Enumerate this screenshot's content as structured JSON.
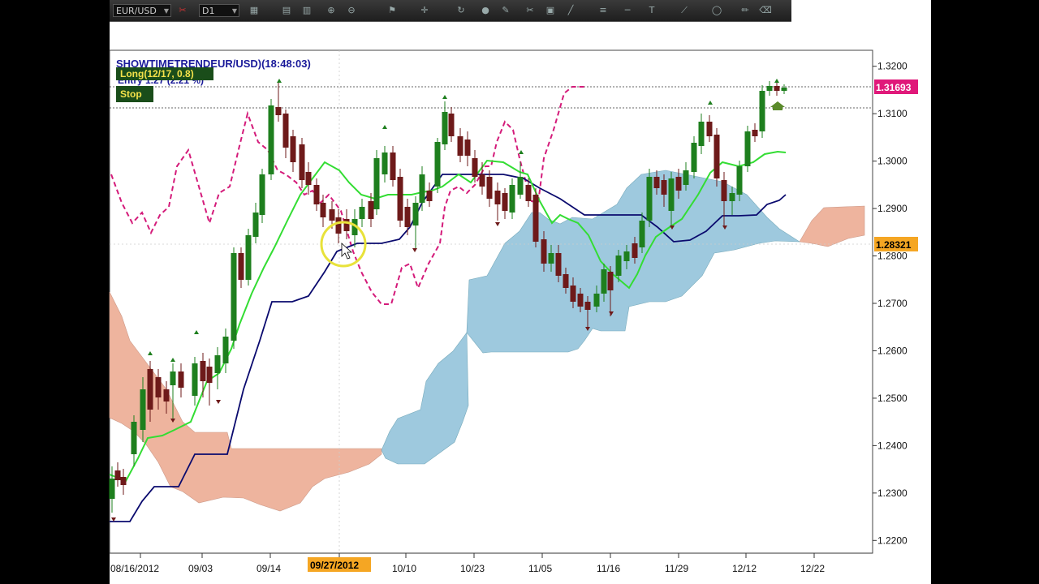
{
  "toolbar": {
    "symbol": "EUR/USD",
    "timeframe": "D1",
    "icons": [
      "chart-icon",
      "grid-icon",
      "table-icon",
      "zoom-in-icon",
      "zoom-out-icon",
      "flag-icon",
      "crosshair-icon",
      "refresh-icon",
      "circle-icon",
      "pencil-icon",
      "scissors-icon",
      "camera-icon",
      "line-tool-icon",
      "fib-icon",
      "hline-icon",
      "text-icon",
      "trend-icon",
      "ellipse-icon",
      "brush-icon",
      "eraser-icon"
    ]
  },
  "indicator": {
    "title": "SHOWTIMETRENDEUR/USD)(18:48:03)",
    "long_label": "Long(12/17, 0.8)",
    "sub_label": "Entry 1.27 (2.21 %)",
    "stop_label": "Stop"
  },
  "price_badges": {
    "current": "1.31693",
    "current_color": "#e0197a",
    "marker": "1.28321",
    "marker_color": "#f5a623"
  },
  "date_badge": "09/27/2012",
  "chart_data": {
    "type": "line",
    "title": "SHOWTIMETRENDEUR/USD)(18:48:03)",
    "y_ticks": [
      "1.3200",
      "1.3100",
      "1.3000",
      "1.2900",
      "1.2800",
      "1.2700",
      "1.2600",
      "1.2500",
      "1.2400",
      "1.2300",
      "1.2200"
    ],
    "x_ticks": [
      "08/16/2012",
      "09/03",
      "09/14",
      "09/27/2012",
      "10/10",
      "10/23",
      "11/05",
      "11/16",
      "11/29",
      "12/12",
      "12/22"
    ],
    "ylim": [
      1.218,
      1.322
    ],
    "colors": {
      "tenkan": "#33dd33",
      "kijun": "#0a0a6e",
      "chikou": "#d41b7a",
      "kumo_bull": "#9ec9de",
      "kumo_bear": "#eeb49e",
      "candle_up": "#1e7f1e",
      "candle_down": "#6e1a1a"
    }
  }
}
